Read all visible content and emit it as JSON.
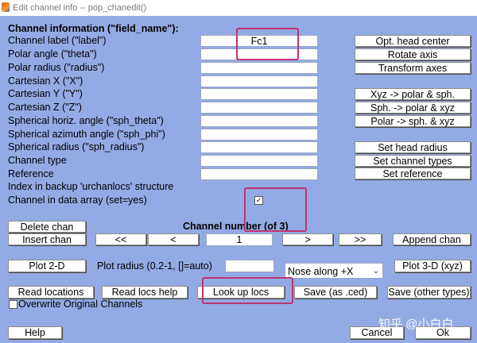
{
  "window": {
    "title": "Edit channel info -- pop_chanedit()"
  },
  "fields_header": "Channel information (\"field_name\"):",
  "fields": [
    {
      "label": "Channel label (\"label\")",
      "value": "Fc1"
    },
    {
      "label": "Polar angle (\"theta\")",
      "value": ""
    },
    {
      "label": "Polar radius (\"radius\")",
      "value": ""
    },
    {
      "label": "Cartesian X (\"X\")",
      "value": ""
    },
    {
      "label": "Cartesian Y (\"Y\")",
      "value": ""
    },
    {
      "label": "Cartesian Z (\"Z\")",
      "value": ""
    },
    {
      "label": "Spherical horiz. angle (\"sph_theta\")",
      "value": ""
    },
    {
      "label": "Spherical azimuth angle (\"sph_phi\")",
      "value": ""
    },
    {
      "label": "Spherical radius (\"sph_radius\")",
      "value": ""
    },
    {
      "label": "Channel type",
      "value": ""
    },
    {
      "label": "Reference",
      "value": ""
    }
  ],
  "urchan_label": "Index in backup 'urchanlocs' structure",
  "data_array_label": "Channel in data array (set=yes)",
  "data_array_checked_mark": "✓",
  "right_buttons": {
    "opt_head_center": "Opt. head center",
    "rotate_axis": "Rotate axis",
    "transform_axes": "Transform axes",
    "xyz_to_polar": "Xyz -> polar & sph.",
    "sph_to_polar": "Sph. -> polar & xyz",
    "polar_to_sph": "Polar -> sph. & xyz",
    "set_head_radius": "Set head radius",
    "set_channel_types": "Set channel types",
    "set_reference": "Set reference"
  },
  "nav": {
    "delete_chan": "Delete chan",
    "insert_chan": "Insert chan",
    "channel_number_label": "Channel number (of 3)",
    "first": "<<",
    "prev": "<",
    "current": "1",
    "next": ">",
    "last": ">>",
    "append_chan": "Append chan"
  },
  "plot": {
    "plot2d": "Plot 2-D",
    "radius_label": "Plot radius (0.2-1, []=auto)",
    "radius_value": "",
    "nose_option": "Nose along +X",
    "plot3d": "Plot 3-D (xyz)"
  },
  "locs": {
    "read_locations": "Read locations",
    "read_locs_help": "Read locs help",
    "look_up_locs": "Look up locs",
    "save_ced": "Save (as .ced)",
    "save_other": "Save (other types)",
    "overwrite_label": "Overwrite Original Channels"
  },
  "bottom": {
    "help": "Help",
    "cancel": "Cancel",
    "ok": "Ok"
  },
  "watermark": "知乎 @小白白",
  "colors": {
    "background": "#93abe4",
    "highlight": "#c0336e"
  }
}
